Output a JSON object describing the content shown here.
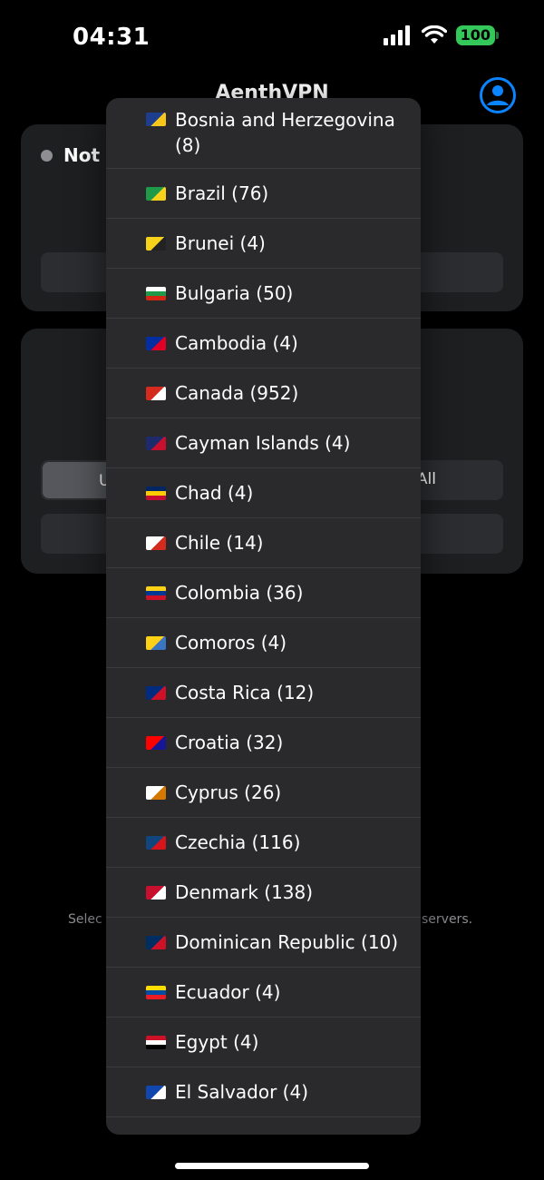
{
  "status_bar": {
    "time": "04:31",
    "battery": "100",
    "signal_icon": "cellular-signal-icon",
    "wifi_icon": "wifi-icon"
  },
  "app": {
    "title": "AenthVPN",
    "profile_icon": "person-circle-icon",
    "accent_color": "#0a84ff"
  },
  "connection": {
    "status": "Not C",
    "status_color": "#8e8e93"
  },
  "segmented": {
    "left": "U",
    "right": "All"
  },
  "hints": {
    "left": "Selec",
    "right": "servers."
  },
  "dropdown": {
    "items": [
      {
        "label": "Bosnia and Herzegovina (8)",
        "flag": "flag-bosnia-icon",
        "colors": [
          "#1d3d8f",
          "#f6c61a"
        ]
      },
      {
        "label": "Brazil (76)",
        "flag": "flag-brazil-icon",
        "colors": [
          "#1f9a49",
          "#f6d21a"
        ]
      },
      {
        "label": "Brunei (4)",
        "flag": "flag-brunei-icon",
        "colors": [
          "#f6d21a",
          "#222222"
        ]
      },
      {
        "label": "Bulgaria (50)",
        "flag": "flag-bulgaria-icon",
        "colors": [
          "#ffffff",
          "#1f9a49",
          "#d62612"
        ]
      },
      {
        "label": "Cambodia (4)",
        "flag": "flag-cambodia-icon",
        "colors": [
          "#032ea1",
          "#e00025"
        ]
      },
      {
        "label": "Canada (952)",
        "flag": "flag-canada-icon",
        "colors": [
          "#d52b1e",
          "#ffffff"
        ]
      },
      {
        "label": "Cayman Islands (4)",
        "flag": "flag-cayman-icon",
        "colors": [
          "#1d2a6b",
          "#c8102e"
        ]
      },
      {
        "label": "Chad (4)",
        "flag": "flag-chad-icon",
        "colors": [
          "#002664",
          "#fecb00",
          "#c60c30"
        ]
      },
      {
        "label": "Chile (14)",
        "flag": "flag-chile-icon",
        "colors": [
          "#ffffff",
          "#d52b1e"
        ]
      },
      {
        "label": "Colombia (36)",
        "flag": "flag-colombia-icon",
        "colors": [
          "#fcd116",
          "#003893",
          "#ce1126"
        ]
      },
      {
        "label": "Comoros (4)",
        "flag": "flag-comoros-icon",
        "colors": [
          "#fcd116",
          "#3a75c4"
        ]
      },
      {
        "label": "Costa Rica (12)",
        "flag": "flag-costa-rica-icon",
        "colors": [
          "#002b7f",
          "#ce1126"
        ]
      },
      {
        "label": "Croatia (32)",
        "flag": "flag-croatia-icon",
        "colors": [
          "#ff0000",
          "#171796"
        ]
      },
      {
        "label": "Cyprus (26)",
        "flag": "flag-cyprus-icon",
        "colors": [
          "#ffffff",
          "#d57800"
        ]
      },
      {
        "label": "Czechia (116)",
        "flag": "flag-czechia-icon",
        "colors": [
          "#11457e",
          "#d7141a"
        ]
      },
      {
        "label": "Denmark (138)",
        "flag": "flag-denmark-icon",
        "colors": [
          "#c8102e",
          "#ffffff"
        ]
      },
      {
        "label": "Dominican Republic (10)",
        "flag": "flag-dominican-icon",
        "colors": [
          "#002d62",
          "#ce1126"
        ]
      },
      {
        "label": "Ecuador (4)",
        "flag": "flag-ecuador-icon",
        "colors": [
          "#ffdd00",
          "#034ea2",
          "#ed1c24"
        ]
      },
      {
        "label": "Egypt (4)",
        "flag": "flag-egypt-icon",
        "colors": [
          "#ce1126",
          "#ffffff",
          "#000000"
        ]
      },
      {
        "label": "El Salvador (4)",
        "flag": "flag-el-salvador-icon",
        "colors": [
          "#0f47af",
          "#ffffff"
        ]
      }
    ]
  }
}
